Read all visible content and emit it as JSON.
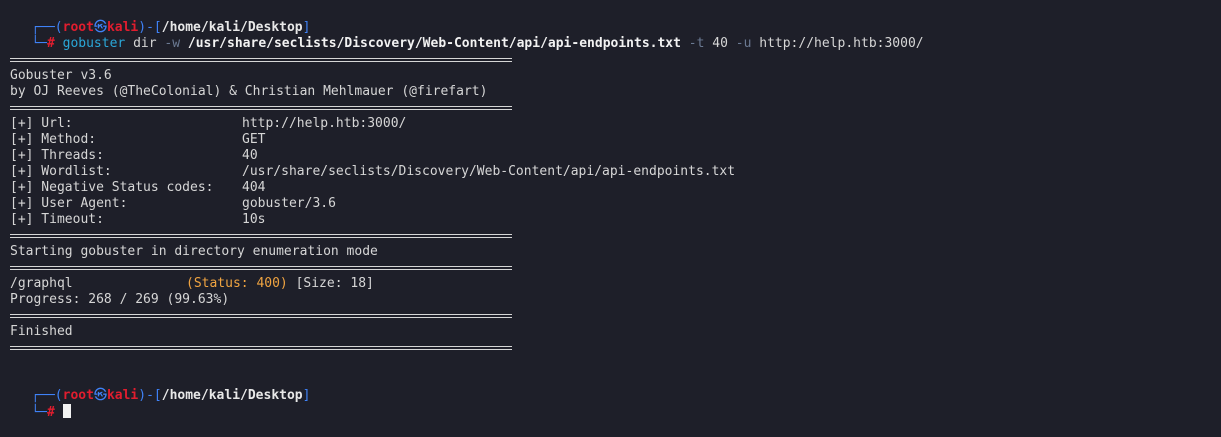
{
  "prompt": {
    "open_corner": "┌──(",
    "user": "root",
    "skull_mark": "㉿",
    "host": "kali",
    "path_open": ")-[",
    "path": "/home/kali/Desktop",
    "path_close": "]",
    "close_corner": "└─",
    "symbol": "#"
  },
  "command": {
    "name": "gobuster",
    "mode": "dir",
    "wordlist_flag": "-w",
    "wordlist": "/usr/share/seclists/Discovery/Web-Content/api/api-endpoints.txt",
    "threads_flag": "-t",
    "threads": "40",
    "url_flag": "-u",
    "url": "http://help.htb:3000/"
  },
  "banner": {
    "version": "Gobuster v3.6",
    "authors": "by OJ Reeves (@TheColonial) & Christian Mehlmauer (@firefart)"
  },
  "settings": [
    {
      "label": "[+] Url:",
      "value": "http://help.htb:3000/"
    },
    {
      "label": "[+] Method:",
      "value": "GET"
    },
    {
      "label": "[+] Threads:",
      "value": "40"
    },
    {
      "label": "[+] Wordlist:",
      "value": "/usr/share/seclists/Discovery/Web-Content/api/api-endpoints.txt"
    },
    {
      "label": "[+] Negative Status codes:",
      "value": "404"
    },
    {
      "label": "[+] User Agent:",
      "value": "gobuster/3.6"
    },
    {
      "label": "[+] Timeout:",
      "value": "10s"
    }
  ],
  "start_message": "Starting gobuster in directory enumeration mode",
  "results": [
    {
      "path": "/graphql",
      "status": "(Status: 400)",
      "size": "[Size: 18]"
    }
  ],
  "progress": "Progress: 268 / 269 (99.63%)",
  "finished": "Finished",
  "colors": {
    "background": "#1e1f29",
    "prompt_blue": "#3f82f7",
    "prompt_red": "#e11d2e",
    "command": "#2aa7d8",
    "flag": "#6b7a93",
    "status_orange": "#f0a441",
    "text": "#d6d6d6"
  }
}
